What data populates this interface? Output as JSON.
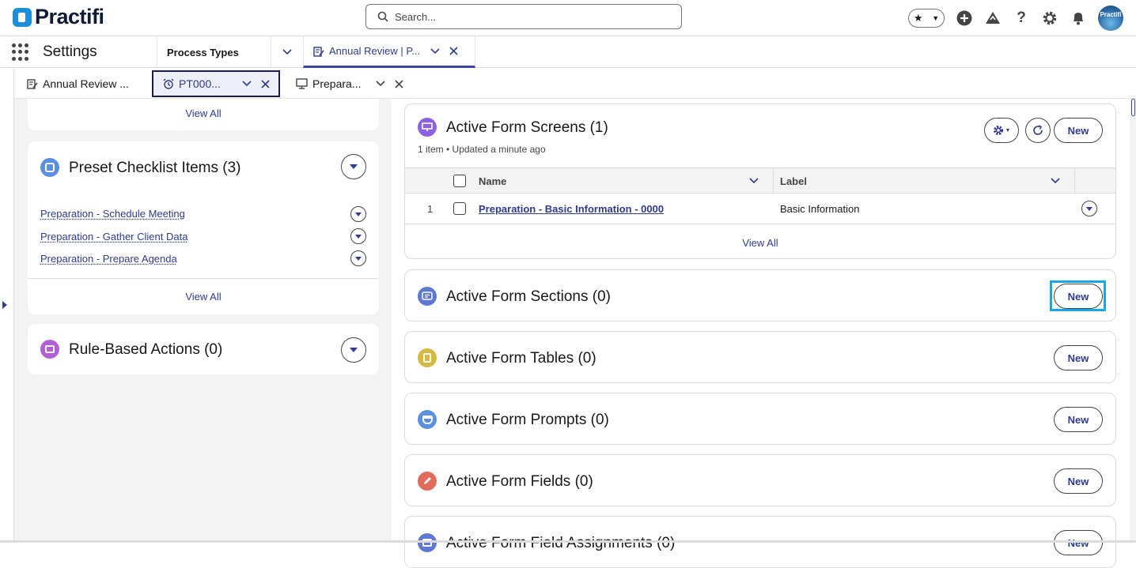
{
  "header": {
    "logo_text": "Practifi",
    "search_placeholder": "Search...",
    "avatar_text": "Practifi",
    "colors": {
      "brand": "#1c8fd8",
      "accent": "#2e3b8f",
      "highlight": "#15a7e6"
    }
  },
  "nav": {
    "app_name": "Settings",
    "items": [
      {
        "label": "Process Types"
      },
      {
        "label": "Annual Review | P..."
      }
    ]
  },
  "subtabs": [
    {
      "label": "Annual Review ..."
    },
    {
      "label": "PT000..."
    },
    {
      "label": "Prepara..."
    }
  ],
  "left": {
    "top_view_all": "View All",
    "checklist": {
      "title": "Preset Checklist Items (3)",
      "items": [
        "Preparation - Schedule Meeting",
        "Preparation - Gather Client Data",
        "Preparation - Prepare Agenda"
      ],
      "view_all": "View All"
    },
    "rules": {
      "title": "Rule-Based Actions (0)"
    }
  },
  "screens": {
    "title": "Active Form Screens (1)",
    "subtitle": "1 item • Updated a minute ago",
    "new_label": "New",
    "columns": [
      "Name",
      "Label"
    ],
    "rows": [
      {
        "num": "1",
        "name": "Preparation - Basic Information - 0000",
        "label": "Basic Information"
      }
    ],
    "view_all": "View All"
  },
  "related": [
    {
      "title": "Active Form Sections (0)",
      "new_label": "New",
      "icon": "form-sections-icon",
      "color": "#5f79d3"
    },
    {
      "title": "Active Form Tables (0)",
      "new_label": "New",
      "icon": "form-tables-icon",
      "color": "#d8b93f"
    },
    {
      "title": "Active Form Prompts (0)",
      "new_label": "New",
      "icon": "form-prompts-icon",
      "color": "#5b8fe0"
    },
    {
      "title": "Active Form Fields (0)",
      "new_label": "New",
      "icon": "form-fields-icon",
      "color": "#e06b5a"
    },
    {
      "title": "Active Form Field Assignments (0)",
      "new_label": "New",
      "icon": "form-field-assignments-icon",
      "color": "#5f79d3"
    }
  ]
}
